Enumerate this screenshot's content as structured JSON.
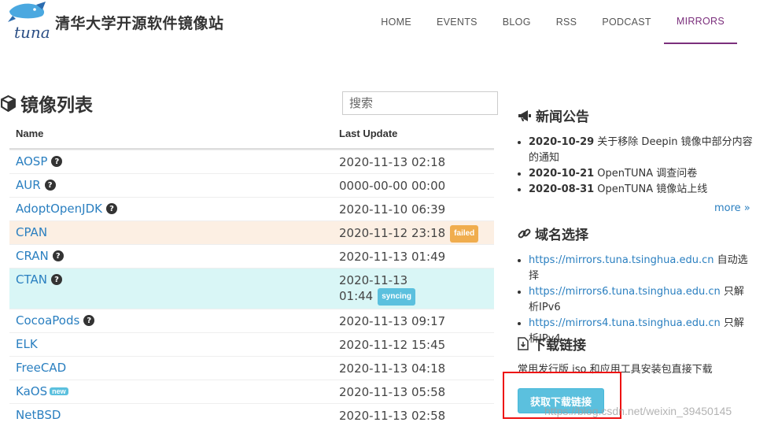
{
  "header": {
    "site_title": "清华大学开源软件镜像站",
    "nav": [
      "HOME",
      "EVENTS",
      "BLOG",
      "RSS",
      "PODCAST",
      "MIRRORS"
    ],
    "active": "MIRRORS"
  },
  "main": {
    "title": "镜像列表",
    "search_placeholder": "搜索",
    "columns": {
      "name": "Name",
      "last_update": "Last Update"
    },
    "rows": [
      {
        "name": "AOSP",
        "date": "2020-11-13 02:18",
        "help": true
      },
      {
        "name": "AUR",
        "date": "0000-00-00 00:00",
        "help": true
      },
      {
        "name": "AdoptOpenJDK",
        "date": "2020-11-10 06:39",
        "help": true
      },
      {
        "name": "CPAN",
        "date": "2020-11-12 23:18",
        "status": "failed"
      },
      {
        "name": "CRAN",
        "date": "2020-11-13 01:49",
        "help": true
      },
      {
        "name": "CTAN",
        "date_line1": "2020-11-13",
        "date_line2": "01:44",
        "status": "syncing",
        "help": true
      },
      {
        "name": "CocoaPods",
        "date": "2020-11-13 09:17",
        "help": true
      },
      {
        "name": "ELK",
        "date": "2020-11-12 15:45"
      },
      {
        "name": "FreeCAD",
        "date": "2020-11-13 04:18"
      },
      {
        "name": "KaOS",
        "date": "2020-11-13 05:58",
        "new": "new"
      },
      {
        "name": "NetBSD",
        "date": "2020-11-13 02:58"
      }
    ]
  },
  "sidebar": {
    "news_title": "新闻公告",
    "news": [
      {
        "date": "2020-10-29",
        "text": "关于移除 Deepin 镜像中部分内容的通知"
      },
      {
        "date": "2020-10-21",
        "text": "OpenTUNA 调查问卷"
      },
      {
        "date": "2020-08-31",
        "text": "OpenTUNA 镜像站上线"
      }
    ],
    "more": "more »",
    "domain_title": "域名选择",
    "domains": [
      {
        "url": "https://mirrors.tuna.tsinghua.edu.cn",
        "note": "自动选择"
      },
      {
        "url": "https://mirrors6.tuna.tsinghua.edu.cn",
        "note": "只解析IPv6"
      },
      {
        "url": "https://mirrors4.tuna.tsinghua.edu.cn",
        "note": "只解析IPv4"
      }
    ],
    "download_title": "下载链接",
    "download_desc": "常用发行版 iso 和应用工具安装包直接下载",
    "download_button": "获取下载链接"
  },
  "watermark": "https://blog.csdn.net/weixin_39450145",
  "colors": {
    "accent": "#7b2f7c",
    "link": "#2a7fc0",
    "info": "#5bc0de",
    "warning": "#f0ad4e"
  }
}
